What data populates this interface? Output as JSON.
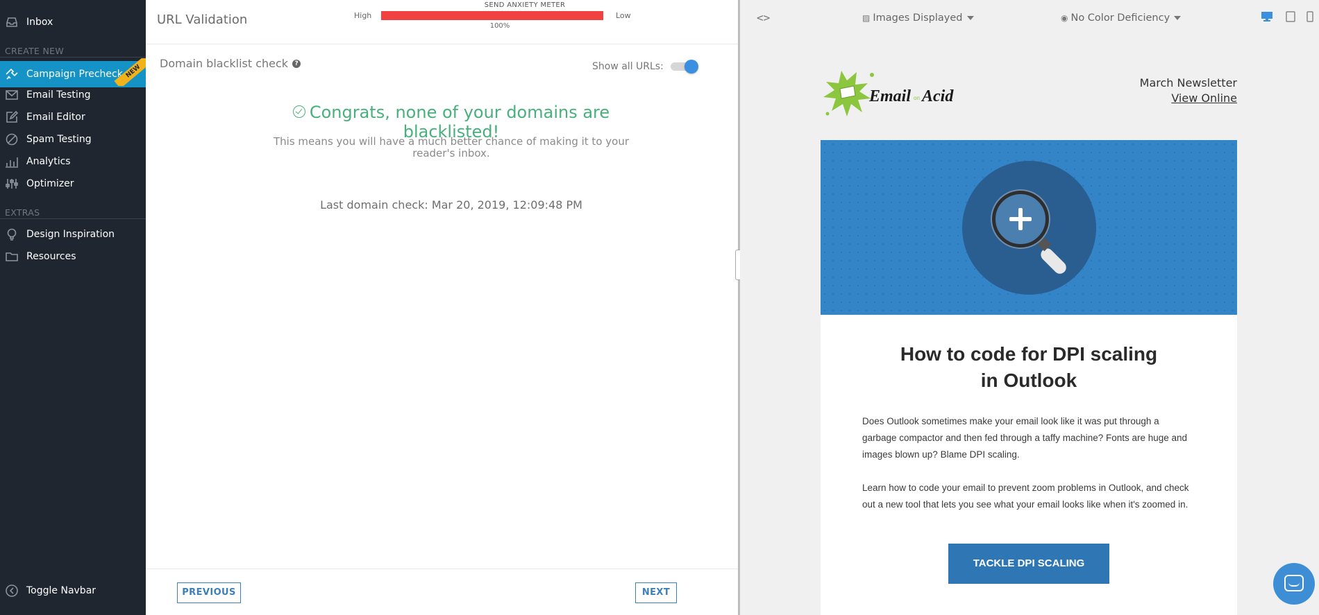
{
  "sidebar": {
    "inbox": "Inbox",
    "section_create": "CREATE NEW",
    "section_extras": "EXTRAS",
    "items": [
      {
        "label": "Campaign Precheck",
        "icon": "precheck-icon",
        "active": true,
        "badge": "NEW"
      },
      {
        "label": "Email Testing",
        "icon": "envelope-icon"
      },
      {
        "label": "Email Editor",
        "icon": "edit-icon"
      },
      {
        "label": "Spam Testing",
        "icon": "ban-icon"
      },
      {
        "label": "Analytics",
        "icon": "bar-chart-icon"
      },
      {
        "label": "Optimizer",
        "icon": "sliders-icon"
      }
    ],
    "extras": [
      {
        "label": "Design Inspiration",
        "icon": "lightbulb-icon"
      },
      {
        "label": "Resources",
        "icon": "folder-icon"
      }
    ],
    "toggle": "Toggle Navbar"
  },
  "header": {
    "title": "URL Validation",
    "meter": {
      "label": "SEND ANXIETY METER",
      "high": "High",
      "low": "Low",
      "percent": "100%",
      "value": 1.0,
      "color": "#f24141"
    }
  },
  "check": {
    "title": "Domain blacklist check",
    "show_urls": "Show all URLs:",
    "show_urls_on": true,
    "congrats": "Congrats, none of your domains are blacklisted!",
    "subtext": "This means you will have a much better chance of making it to your reader's inbox.",
    "last_check": "Last domain check: Mar 20, 2019, 12:09:48 PM"
  },
  "footer": {
    "previous": "PREVIOUS",
    "next": "NEXT"
  },
  "preview": {
    "code_toggle": "<>",
    "images": "Images Displayed",
    "color": "No Color Deficiency",
    "email": {
      "logo_text_a": "Email",
      "logo_text_on": "on",
      "logo_text_b": "Acid",
      "newsletter": "March Newsletter",
      "view_online": "View Online",
      "headline_l1": "How to code for DPI scaling",
      "headline_l2": "in Outlook",
      "p1": "Does Outlook sometimes make your email look like it was put through a garbage compactor and then fed through a taffy machine? Fonts are huge and images blown up? Blame DPI scaling.",
      "p2": "Learn how to code your email to prevent zoom problems in Outlook, and check out a new tool that lets you see what your email looks like when it's zoomed in.",
      "cta": "TACKLE DPI SCALING"
    }
  },
  "colors": {
    "sidebar_bg": "#1f2630",
    "accent": "#1593c6",
    "success": "#48b07c",
    "button": "#2f76b5",
    "badge": "#f2b21a"
  }
}
